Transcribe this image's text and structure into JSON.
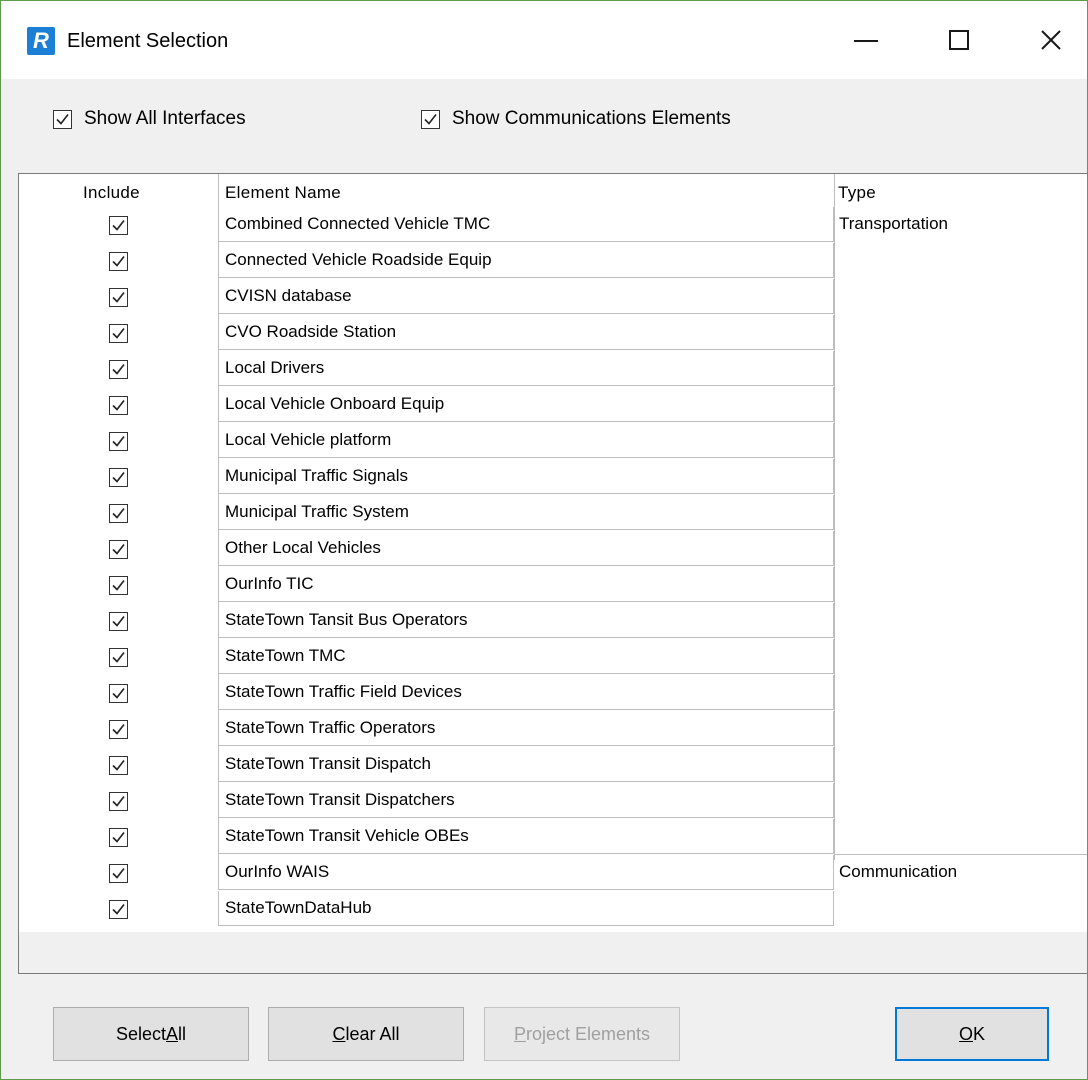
{
  "window": {
    "title": "Element Selection",
    "icon_letter": "R",
    "accent_color": "#1c7fd6"
  },
  "options": {
    "show_all_interfaces": {
      "label": "Show All Interfaces",
      "checked": true
    },
    "show_communications": {
      "label": "Show Communications Elements",
      "checked": true
    }
  },
  "table": {
    "headers": {
      "include": "Include",
      "name": "Element Name",
      "type": "Type"
    },
    "groups": [
      {
        "type": "Transportation",
        "start": 0,
        "count": 18
      },
      {
        "type": "Communication",
        "start": 18,
        "count": 2
      }
    ],
    "rows": [
      {
        "name": "Combined Connected Vehicle TMC",
        "include": true
      },
      {
        "name": "Connected Vehicle Roadside Equip",
        "include": true
      },
      {
        "name": "CVISN database",
        "include": true
      },
      {
        "name": "CVO Roadside Station",
        "include": true
      },
      {
        "name": "Local Drivers",
        "include": true
      },
      {
        "name": "Local Vehicle Onboard Equip",
        "include": true
      },
      {
        "name": "Local Vehicle platform",
        "include": true
      },
      {
        "name": "Municipal Traffic Signals",
        "include": true
      },
      {
        "name": "Municipal Traffic System",
        "include": true
      },
      {
        "name": "Other Local Vehicles",
        "include": true
      },
      {
        "name": "OurInfo TIC",
        "include": true
      },
      {
        "name": "StateTown Tansit Bus Operators",
        "include": true
      },
      {
        "name": "StateTown TMC",
        "include": true
      },
      {
        "name": "StateTown Traffic Field Devices",
        "include": true
      },
      {
        "name": "StateTown Traffic Operators",
        "include": true
      },
      {
        "name": "StateTown Transit Dispatch",
        "include": true
      },
      {
        "name": "StateTown Transit Dispatchers",
        "include": true
      },
      {
        "name": "StateTown Transit Vehicle OBEs",
        "include": true
      },
      {
        "name": "OurInfo WAIS",
        "include": true
      },
      {
        "name": "StateTownDataHub",
        "include": true
      }
    ]
  },
  "buttons": {
    "select_all": {
      "pre": "Select ",
      "key": "A",
      "post": "ll"
    },
    "clear_all": {
      "pre": "",
      "key": "C",
      "post": "lear All"
    },
    "project_elements": {
      "pre": "",
      "key": "P",
      "post": "roject Elements",
      "disabled": true
    },
    "ok": {
      "pre": "",
      "key": "O",
      "post": "K"
    }
  }
}
